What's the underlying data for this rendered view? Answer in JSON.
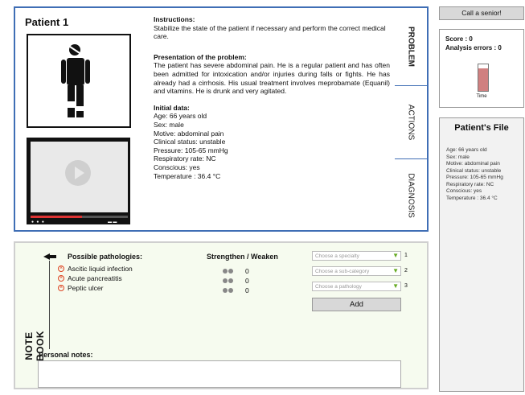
{
  "patient": {
    "title": "Patient 1",
    "instructions_heading": "Instructions:",
    "instructions_text": "Stabilize the state of the patient if necessary and perform the correct medical care.",
    "presentation_heading": "Presentation of the problem:",
    "presentation_text": "The patient has severe abdominal pain. He is a regular patient and has often been admitted for intoxication and/or injuries during falls or fights. He has already had a cirrhosis. His usual treatment involves meprobamate (Equanil) and vitamins. He is drunk and very agitated.",
    "initial_heading": "Initial data:",
    "initial_data": [
      "Age: 66 years old",
      "Sex: male",
      "Motive: abdominal pain",
      "Clinical status: unstable",
      "Pressure: 105-65 mmHg",
      "Respiratory rate: NC",
      "Conscious: yes",
      "Temperature : 36.4 °C"
    ]
  },
  "tabs": [
    "PROBLEM",
    "ACTIONS",
    "DIAGNOSIS"
  ],
  "active_tab": "PROBLEM",
  "notebook": {
    "label": "NOTE BOOK",
    "pathologies_heading": "Possible pathologies:",
    "pathologies": [
      "Ascitic liquid infection",
      "Acute pancreatitis",
      "Peptic ulcer"
    ],
    "strengthen_heading": "Strengthen / Weaken",
    "scores": [
      "0",
      "0",
      "0"
    ],
    "selects": [
      {
        "placeholder": "Choose a specialty",
        "num": "1"
      },
      {
        "placeholder": "Choose a sub-category",
        "num": "2"
      },
      {
        "placeholder": "Choose a pathology",
        "num": "3"
      }
    ],
    "add_label": "Add",
    "notes_label": "Personal notes:",
    "notes_value": ""
  },
  "sidebar": {
    "call_label": "Call a senior!",
    "score": "Score : 0",
    "analysis_errors": "Analysis errors : 0",
    "time_label": "Time",
    "time_fraction": 0.85,
    "time_color": "#d08080",
    "file_title": "Patient's File",
    "file_data": [
      "Age: 66 years old",
      "Sex: male",
      "Motive: abdominal pain",
      "Clinical status: unstable",
      "Pressure: 105-65 mmHg",
      "Respiratory rate: NC",
      "Conscious: yes",
      "Temperature : 36.4 °C"
    ]
  },
  "colors": {
    "accent": "#3f6eb5",
    "notebook_bg": "#f6fbef",
    "pathology_icon": "#d42"
  },
  "icons": [
    "patient-figure-icon",
    "play-icon",
    "pointing-hand-icon",
    "remove-icon",
    "strengthen-icon",
    "weaken-icon",
    "dropdown-arrow-icon"
  ]
}
